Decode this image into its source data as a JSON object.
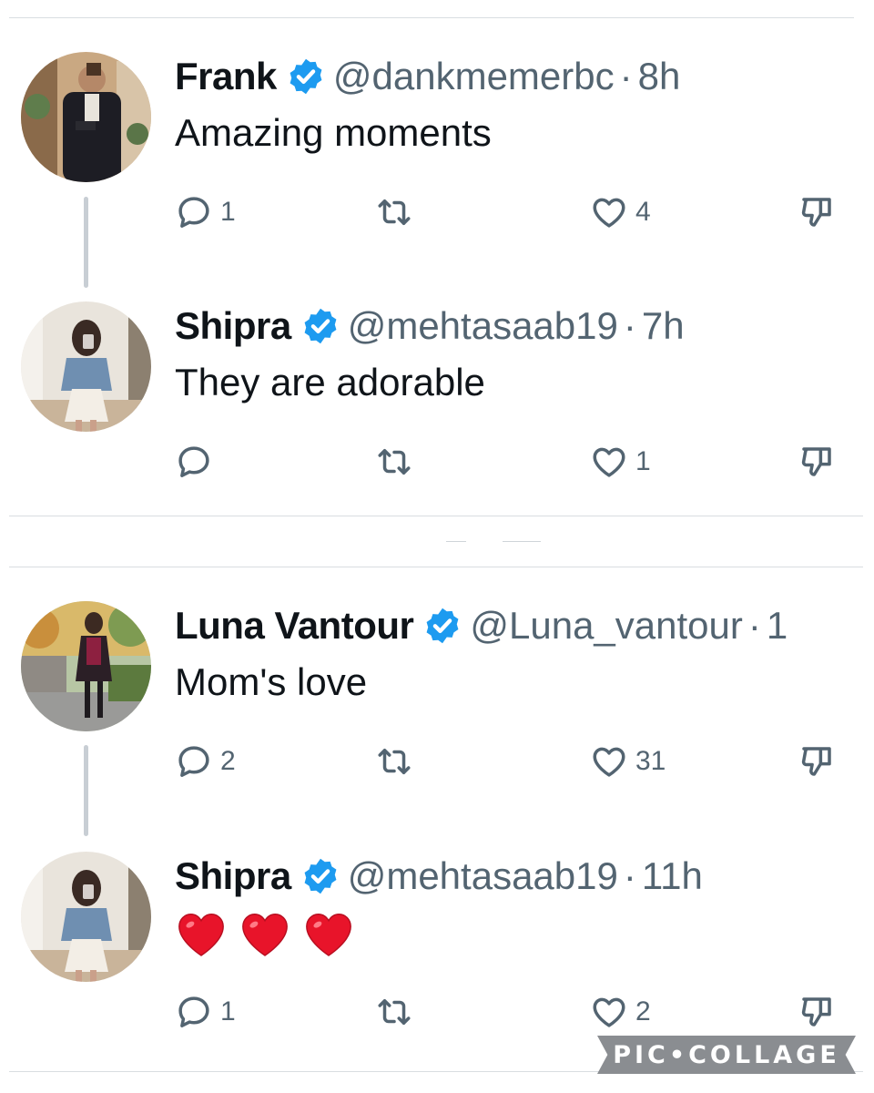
{
  "tweets": [
    {
      "name": "Frank",
      "handle": "@dankmemerbc",
      "separator": "·",
      "time": "8h",
      "text": "Amazing moments",
      "reply_count": "1",
      "retweet_count": "",
      "like_count": "4"
    },
    {
      "name": "Shipra",
      "handle": "@mehtasaab19",
      "separator": "·",
      "time": "7h",
      "text": "They are adorable",
      "reply_count": "",
      "retweet_count": "",
      "like_count": "1"
    },
    {
      "name": "Luna Vantour",
      "handle": "@Luna_vantour",
      "separator": "·",
      "time": "1",
      "text": "Mom's love",
      "reply_count": "2",
      "retweet_count": "",
      "like_count": "31"
    },
    {
      "name": "Shipra",
      "handle": "@mehtasaab19",
      "separator": "·",
      "time": "11h",
      "text": "❤️❤️❤️",
      "reply_count": "1",
      "retweet_count": "",
      "like_count": "2"
    }
  ],
  "watermark": "PIC•COLLAGE",
  "colors": {
    "verified": "#1d9bf0",
    "muted": "#536471",
    "heart_emoji": "#e8142a"
  },
  "icons": [
    "reply-icon",
    "retweet-icon",
    "like-icon",
    "dislike-icon",
    "verified-badge-icon"
  ]
}
